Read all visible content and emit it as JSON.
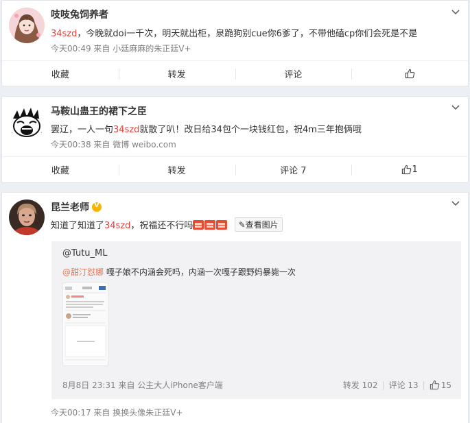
{
  "posts": [
    {
      "username": "吱吱兔饲养者",
      "content_pre": "",
      "content_hl": "34szd",
      "content_post": "，今晚就doi一千次，明天就出柜，泉跪狗别cue你6爹了，不带他磕cp你们会死是不是",
      "time": "今天00:49",
      "source_prefix": "来自",
      "source": "小廷麻麻的朱正廷V+",
      "actions": {
        "collect": "收藏",
        "forward": "转发",
        "comment": "评论",
        "like": ""
      }
    },
    {
      "username": "马鞍山蛊王的裙下之臣",
      "content_pre": "罢辽，一人一句",
      "content_hl": "34szd",
      "content_post": "就散了叭！改日给34包个一块钱红包，祝4m三年抱俩哦",
      "time": "今天00:38",
      "source_prefix": "来自",
      "source": "微博 weibo.com",
      "actions": {
        "collect": "收藏",
        "forward": "转发",
        "comment": "评论 7",
        "like": "1"
      }
    },
    {
      "username": "昆兰老师",
      "content_pre": "知道了知道了",
      "content_hl": "34szd",
      "content_post": "，祝福还不行吗",
      "pic_button": "查看图片",
      "quote": {
        "author": "@Tutu_ML",
        "mention": "@甜汀怼娜",
        "text": " 嘎子娘不内涵会死吗，内涵一次嘎子跟野妈暴毙一次",
        "meta": "8月8日 23:31 来自 公主大人iPhone客户端",
        "forward": "转发 102",
        "comment": "评论 13",
        "like": "15"
      },
      "time": "今天00:17",
      "source_prefix": "来自",
      "source": "换换头像朱正廷V+"
    }
  ],
  "colors": {
    "highlight": "#e8413b",
    "mention": "#eb7350",
    "verified": "#f7b500",
    "meta": "#808080"
  }
}
